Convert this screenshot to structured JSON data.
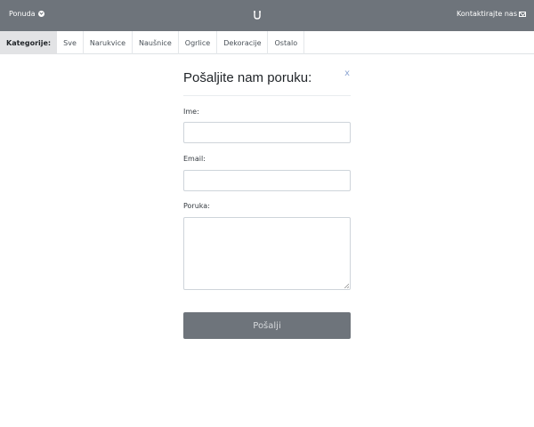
{
  "topbar": {
    "left_label": "Ponuda",
    "right_label": "Kontaktirajte nas"
  },
  "categories": {
    "label": "Kategorije:",
    "tabs": [
      "Sve",
      "Narukvice",
      "Naušnice",
      "Ogrlice",
      "Dekoracije",
      "Ostalo"
    ]
  },
  "form": {
    "title": "Pošaljite nam poruku:",
    "close": "x",
    "name_label": "Ime:",
    "name_value": "",
    "email_label": "Email:",
    "email_value": "",
    "message_label": "Poruka:",
    "message_value": "",
    "submit_label": "Pošalji"
  }
}
